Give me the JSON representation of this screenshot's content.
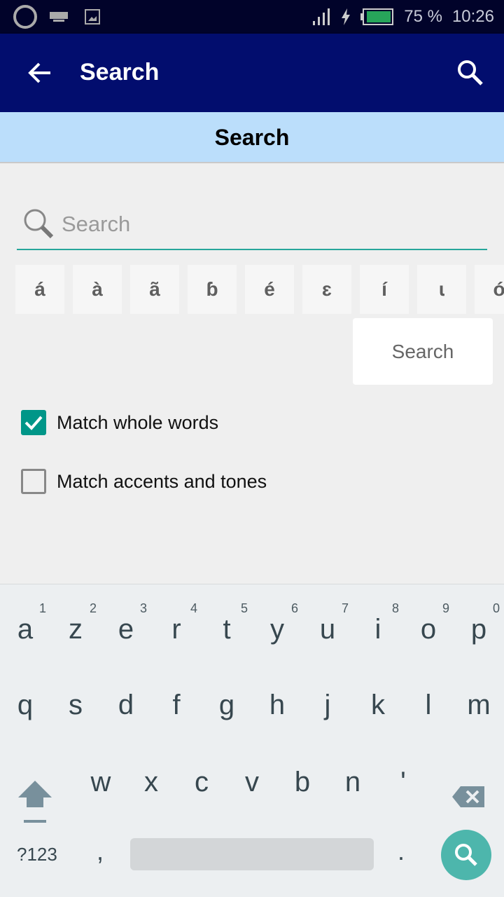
{
  "status": {
    "battery": "75 %",
    "time": "10:26",
    "battery_level": 0.75
  },
  "appbar": {
    "title": "Search"
  },
  "subheader": {
    "title": "Search"
  },
  "search": {
    "placeholder": "Search",
    "value": ""
  },
  "special_chars": [
    "á",
    "à",
    "ã",
    "ɓ",
    "é",
    "ɛ",
    "í",
    "ɩ",
    "ó"
  ],
  "search_button": "Search",
  "options": [
    {
      "label": "Match whole words",
      "checked": true
    },
    {
      "label": "Match accents and tones",
      "checked": false
    }
  ],
  "keyboard": {
    "row1": [
      {
        "k": "a",
        "h": "1"
      },
      {
        "k": "z",
        "h": "2"
      },
      {
        "k": "e",
        "h": "3"
      },
      {
        "k": "r",
        "h": "4"
      },
      {
        "k": "t",
        "h": "5"
      },
      {
        "k": "y",
        "h": "6"
      },
      {
        "k": "u",
        "h": "7"
      },
      {
        "k": "i",
        "h": "8"
      },
      {
        "k": "o",
        "h": "9"
      },
      {
        "k": "p",
        "h": "0"
      }
    ],
    "row2": [
      "q",
      "s",
      "d",
      "f",
      "g",
      "h",
      "j",
      "k",
      "l",
      "m"
    ],
    "row3": [
      "w",
      "x",
      "c",
      "v",
      "b",
      "n",
      "'"
    ],
    "symbols": "?123",
    "comma": ",",
    "period": "."
  },
  "colors": {
    "accent": "#009688",
    "appbar": "#020d6e",
    "subheader": "#bbdefb"
  }
}
